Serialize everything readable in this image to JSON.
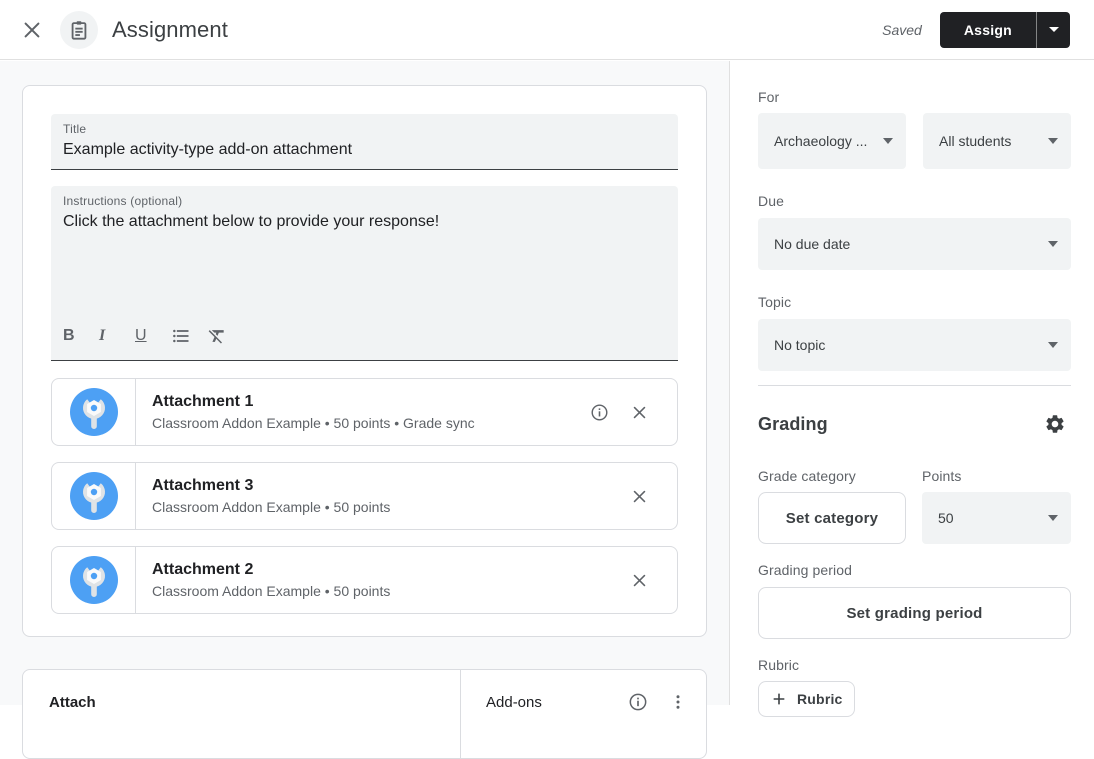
{
  "header": {
    "title": "Assignment",
    "saved_status": "Saved",
    "assign_label": "Assign"
  },
  "form": {
    "title_field": {
      "label": "Title",
      "value": "Example activity-type add-on attachment"
    },
    "instructions_field": {
      "label": "Instructions (optional)",
      "value": "Click the attachment below to provide your response!"
    },
    "toolbar": {
      "bold": "B",
      "italic": "I",
      "underline": "U"
    },
    "attachments": [
      {
        "title": "Attachment 1",
        "meta": "Classroom Addon Example • 50 points • Grade sync"
      },
      {
        "title": "Attachment 3",
        "meta": "Classroom Addon Example • 50 points"
      },
      {
        "title": "Attachment 2",
        "meta": "Classroom Addon Example • 50 points"
      }
    ],
    "attach_bar": {
      "attach_label": "Attach",
      "addons_label": "Add-ons"
    }
  },
  "sidebar": {
    "for_section": {
      "label": "For",
      "course_value": "Archaeology ...",
      "students_value": "All students"
    },
    "due_section": {
      "label": "Due",
      "value": "No due date"
    },
    "topic_section": {
      "label": "Topic",
      "value": "No topic"
    },
    "grading": {
      "heading": "Grading",
      "grade_category_label": "Grade category",
      "set_category_label": "Set category",
      "points_label": "Points",
      "points_value": "50",
      "grading_period_label": "Grading period",
      "set_grading_period_label": "Set grading period",
      "rubric_label": "Rubric",
      "rubric_button_label": "Rubric"
    }
  },
  "colors": {
    "addon_icon_blue": "#4da0f4",
    "assign_button_dark": "#202124",
    "field_background": "#f1f3f4",
    "border_gray": "#dadce0",
    "text_gray": "#5f6368"
  }
}
